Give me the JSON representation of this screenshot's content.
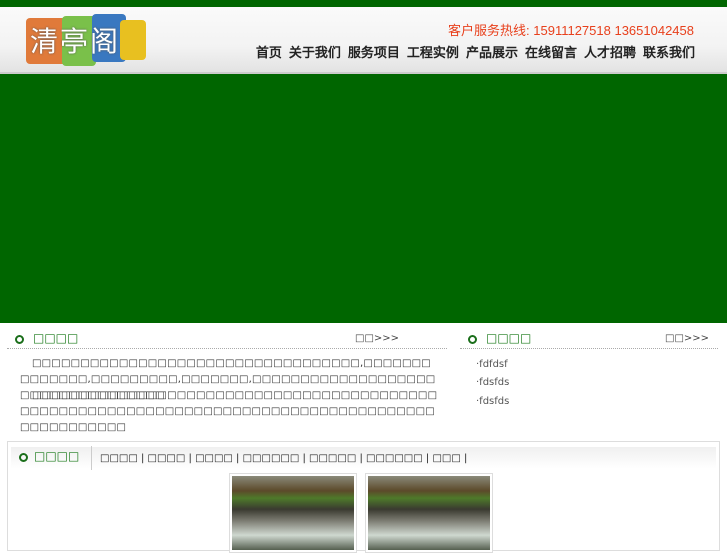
{
  "header": {
    "logo_text": "清亭阁",
    "hotline": "客户服务热线: 15911127518  13651042458"
  },
  "nav": [
    "首页",
    "关于我们",
    "服务项目",
    "工程实例",
    "产品展示",
    "在线留言",
    "人才招聘",
    "联系我们"
  ],
  "about": {
    "title": "□□□□",
    "more": "□□>>>",
    "p1": "□□□□□□□□□□□□□□□□□□□□□□□□□□□□□□□□□□,□□□□□□□□□□□□□□,□□□□□□□□□,□□□□□□□,□□□□□□□□□□□□□□□□□□□□□□□□□□□□□□□□□□",
    "p2": "□□□□□□□□□□□□□□□□□□□□□□□□□□□□□□□□□□□□□□□□□□□□□□□□□□□□□□□□□□□□□□□□□□□□□□□□□□□□□□□□□□□□□□□□□□□□□□□□"
  },
  "news": {
    "title": "□□□□",
    "more": "□□>>>",
    "items": [
      "·fdfdsf",
      "·fdsfds",
      "·fdsfds"
    ]
  },
  "products": {
    "title": "□□□□",
    "tabs": [
      "□□□□",
      "□□□□",
      "□□□□",
      "□□□□□□",
      "□□□□□",
      "□□□□□□",
      "□□□"
    ]
  }
}
